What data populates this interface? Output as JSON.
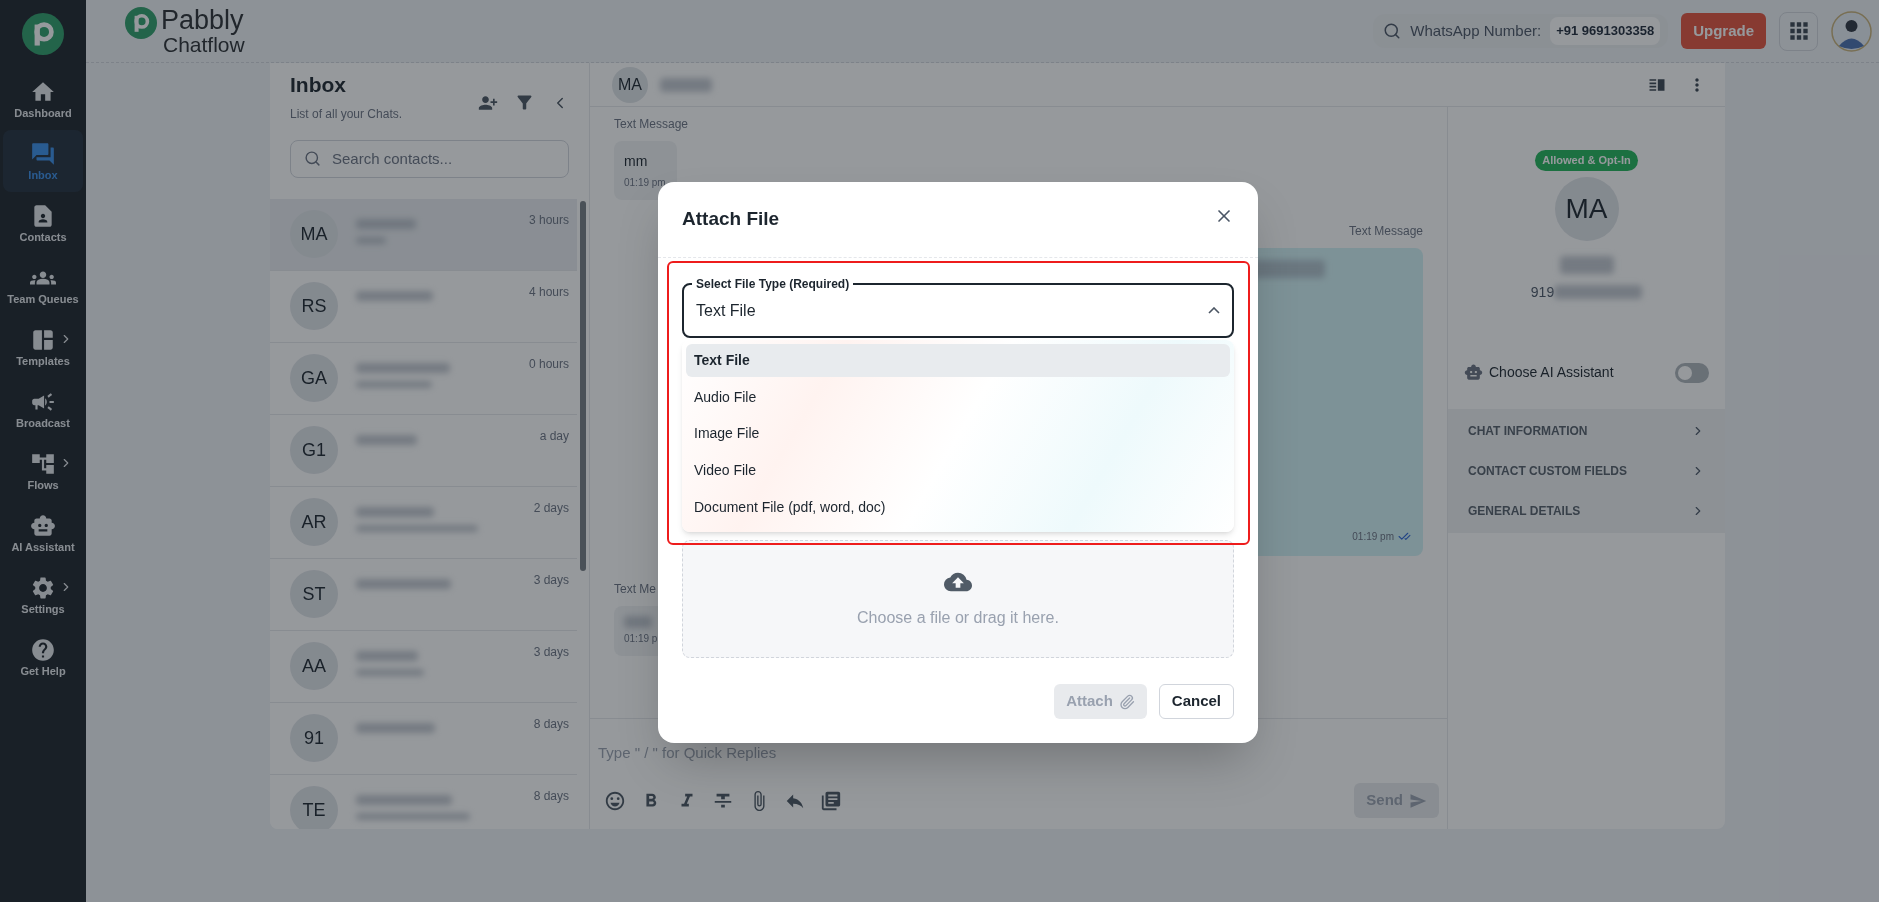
{
  "sidebar": {
    "items": [
      {
        "label": "Dashboard",
        "selected": false,
        "expandable": false
      },
      {
        "label": "Inbox",
        "selected": true,
        "expandable": false
      },
      {
        "label": "Contacts",
        "selected": false,
        "expandable": false
      },
      {
        "label": "Team Queues",
        "selected": false,
        "expandable": false
      },
      {
        "label": "Templates",
        "selected": false,
        "expandable": true
      },
      {
        "label": "Broadcast",
        "selected": false,
        "expandable": false
      },
      {
        "label": "Flows",
        "selected": false,
        "expandable": true
      },
      {
        "label": "AI Assistant",
        "selected": false,
        "expandable": false
      },
      {
        "label": "Settings",
        "selected": false,
        "expandable": true
      },
      {
        "label": "Get Help",
        "selected": false,
        "expandable": false
      }
    ]
  },
  "header": {
    "logo": {
      "line_1": "Pabbly",
      "line_2": "Chatflow"
    },
    "whatsapp": {
      "label": "WhatsApp Number:",
      "value": "+91 9691303358"
    },
    "upgrade_button": "Upgrade"
  },
  "inbox": {
    "title": "Inbox",
    "subtitle": "List of all your Chats.",
    "search_placeholder": "Search contacts...",
    "contacts": [
      {
        "initials": "MA",
        "time": "3 hours",
        "selected": true
      },
      {
        "initials": "RS",
        "time": "4 hours",
        "selected": false
      },
      {
        "initials": "GA",
        "time": "0 hours",
        "selected": false
      },
      {
        "initials": "G1",
        "time": "a day",
        "selected": false
      },
      {
        "initials": "AR",
        "time": "2 days",
        "selected": false
      },
      {
        "initials": "ST",
        "time": "3 days",
        "selected": false
      },
      {
        "initials": "AA",
        "time": "3 days",
        "selected": false
      },
      {
        "initials": "91",
        "time": "8 days",
        "selected": false
      },
      {
        "initials": "TE",
        "time": "8 days",
        "selected": false
      }
    ]
  },
  "chat": {
    "contact_initials": "MA",
    "messages": [
      {
        "kind": "incoming",
        "label": "Text Message",
        "text": "mm",
        "time": "01:19 pm"
      },
      {
        "kind": "outgoing",
        "label": "Text Message",
        "time": "01:19 pm",
        "read": true
      },
      {
        "kind": "incoming",
        "label": "Text Me",
        "time": "01:19 p"
      }
    ],
    "composer": {
      "placeholder": "Type \" / \" for Quick Replies",
      "send": {
        "label": "Send",
        "disabled": true
      }
    }
  },
  "contact_panel": {
    "badge": "Allowed & Opt-In",
    "initials": "MA",
    "phone": "919",
    "ai_assistant": {
      "label": "Choose AI Assistant",
      "on": false
    },
    "sections": [
      {
        "title": "CHAT INFORMATION"
      },
      {
        "title": "CONTACT CUSTOM FIELDS"
      },
      {
        "title": "GENERAL DETAILS"
      }
    ]
  },
  "modal": {
    "title": "Attach File",
    "select": {
      "label": "Select File Type (Required)",
      "value": "Text File",
      "expanded": true
    },
    "options": [
      {
        "label": "Text File",
        "selected": true
      },
      {
        "label": "Audio File",
        "selected": false
      },
      {
        "label": "Image File",
        "selected": false
      },
      {
        "label": "Video File",
        "selected": false
      },
      {
        "label": "Document File (pdf, word, doc)",
        "selected": false
      }
    ],
    "upload_hint": "Choose a file or drag it here.",
    "attach_button": {
      "label": "Attach",
      "disabled": true
    },
    "cancel_button": "Cancel"
  }
}
